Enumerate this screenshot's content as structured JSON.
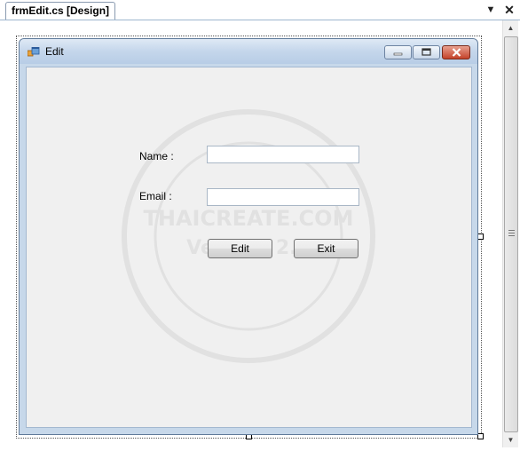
{
  "document_tab": {
    "title": "frmEdit.cs [Design]",
    "dropdown_glyph": "▼",
    "close_glyph": "✕"
  },
  "form": {
    "title": "Edit",
    "icon": "form-icon",
    "caption_buttons": [
      "minimize",
      "maximize",
      "close"
    ]
  },
  "fields": {
    "name_label": "Name :",
    "name_value": "",
    "email_label": "Email :",
    "email_value": ""
  },
  "buttons": {
    "edit_label": "Edit",
    "exit_label": "Exit"
  },
  "watermark": {
    "line1": "THAICREATE.COM",
    "line2": "Version 2.0"
  },
  "scrollbar": {
    "up_glyph": "▲",
    "down_glyph": "▼"
  },
  "colors": {
    "titlebar_top": "#dfe9f5",
    "titlebar_bottom": "#b8cde6",
    "client_bg": "#f0f0f0",
    "close_button": "#c4422a"
  }
}
